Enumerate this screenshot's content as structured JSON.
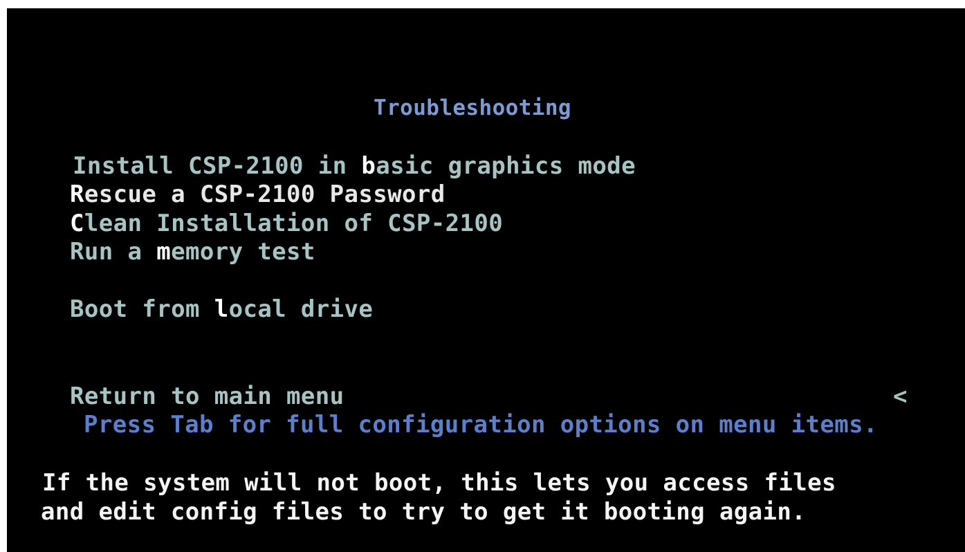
{
  "menu": {
    "title": "Troubleshooting",
    "items": [
      {
        "pre": "Install CSP-2100 in ",
        "hotkey": "b",
        "post": "asic graphics mode"
      },
      {
        "pre": "",
        "hotkey": "R",
        "post": "escue a CSP-2100 Password"
      },
      {
        "pre": "",
        "hotkey": "C",
        "post": "lean Installation of CSP-2100"
      },
      {
        "pre": "Run a ",
        "hotkey": "m",
        "post": "emory test"
      },
      {
        "pre": "Boot from ",
        "hotkey": "l",
        "post": "ocal drive"
      },
      {
        "pre": "Return to main menu",
        "hotkey": "",
        "post": ""
      }
    ],
    "selected_index": 1,
    "submenu_arrow": "<",
    "hint": "Press Tab for full configuration options on menu items.",
    "help": {
      "line1": "If the system will not boot, this lets you access files",
      "line2": "and edit config files to try to get it booting again."
    }
  },
  "colors": {
    "background": "#000000",
    "title": "#7b9bd4",
    "item": "#a6c4c4",
    "selected": "#e8e8e8",
    "hotkey": "#ffffff",
    "hint": "#5b7fcc",
    "help": "#f4f4f4"
  }
}
